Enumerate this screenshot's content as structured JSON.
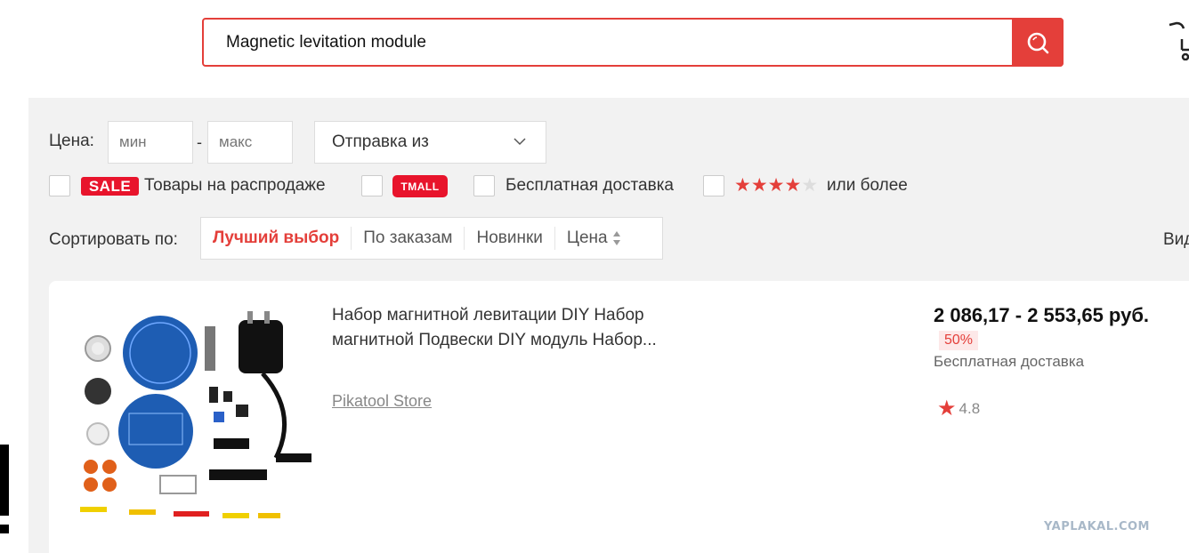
{
  "search": {
    "query": "Magnetic levitation module"
  },
  "filters": {
    "price_label": "Цена:",
    "min_placeholder": "мин",
    "dash": "-",
    "max_placeholder": "макс",
    "ship_from": "Отправка из",
    "sale_badge": "SALE",
    "sale_label": "Товары на распродаже",
    "tmall_badge": "TMALL",
    "free_shipping_label": "Бесплатная доставка",
    "rating_stars": 4,
    "rating_label": "или более"
  },
  "sort": {
    "label": "Сортировать по:",
    "options": [
      "Лучший выбор",
      "По заказам",
      "Новинки",
      "Цена"
    ],
    "active": 0,
    "view_label": "Вид"
  },
  "product": {
    "title": "Набор магнитной левитации DIY Набор магнитной Подвески DIY модуль Набор...",
    "store": "Pikatool Store",
    "price": "2 086,17 - 2 553,65 руб.",
    "discount": "50%",
    "delivery": "Бесплатная доставка",
    "rating": "4.8"
  },
  "watermark": "YAPLAKAL.COM",
  "colors": {
    "accent": "#e43f3a",
    "badge": "#e8142c",
    "background": "#f2f2f2"
  }
}
